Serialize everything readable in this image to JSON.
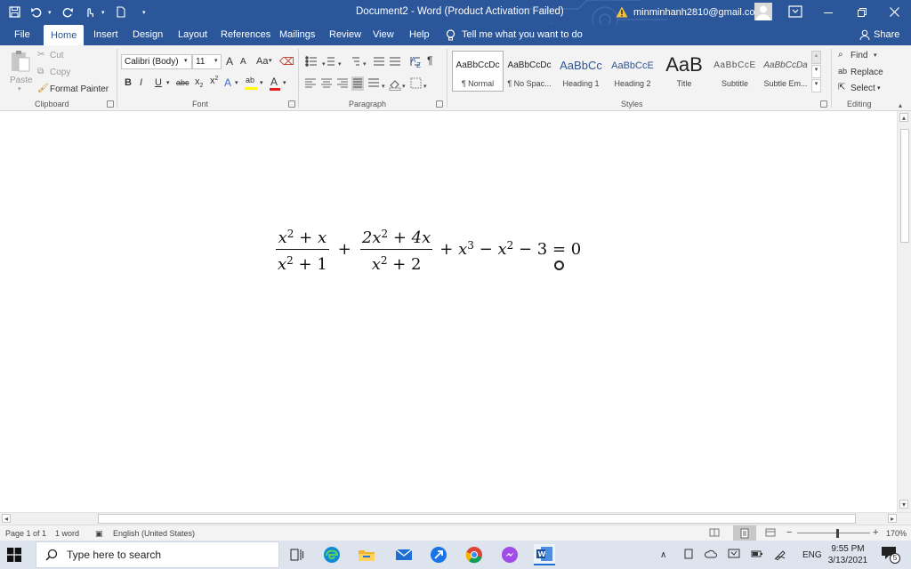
{
  "window": {
    "title": "Document2  -  Word (Product Activation Failed)",
    "account_email": "minminhanh2810@gmail.com"
  },
  "tabs": [
    "File",
    "Home",
    "Insert",
    "Design",
    "Layout",
    "References",
    "Mailings",
    "Review",
    "View",
    "Help"
  ],
  "active_tab": "Home",
  "tell_me": "Tell me what you want to do",
  "share": "Share",
  "clipboard": {
    "paste": "Paste",
    "cut": "Cut",
    "copy": "Copy",
    "format_painter": "Format Painter",
    "label": "Clipboard"
  },
  "font": {
    "name": "Calibri (Body)",
    "size": "11",
    "label": "Font",
    "bold": "B",
    "italic": "I",
    "underline": "U",
    "strike": "abc",
    "subscript": "x",
    "superscript": "x",
    "grow": "A",
    "shrink": "A",
    "case": "Aa",
    "text_effects": "A",
    "font_color": "A"
  },
  "paragraph": {
    "label": "Paragraph",
    "pilcrow": "¶"
  },
  "styles": {
    "label": "Styles",
    "items": [
      {
        "sample": "AaBbCcDc",
        "name": "¶ Normal"
      },
      {
        "sample": "AaBbCcDc",
        "name": "¶ No Spac..."
      },
      {
        "sample": "AaBbCc",
        "name": "Heading 1"
      },
      {
        "sample": "AaBbCcE",
        "name": "Heading 2"
      },
      {
        "sample": "AaB",
        "name": "Title"
      },
      {
        "sample": "AaBbCcE",
        "name": "Subtitle"
      },
      {
        "sample": "AaBbCcDa",
        "name": "Subtle Em..."
      }
    ]
  },
  "editing": {
    "label": "Editing",
    "find": "Find",
    "replace": "Replace",
    "select": "Select"
  },
  "equation": {
    "frac1_num_a": "x",
    "frac1_num_exp": "2",
    "frac1_num_b": "+ x",
    "frac1_den_a": "x",
    "frac1_den_exp": "2",
    "frac1_den_b": "+ 1",
    "plus": "+",
    "frac2_num_a": "2x",
    "frac2_num_exp": "2",
    "frac2_num_b": "+ 4x",
    "frac2_den_a": "x",
    "frac2_den_exp": "2",
    "frac2_den_b": "+ 2",
    "tail_a": "+ x",
    "tail_exp1": "3",
    "tail_b": "− x",
    "tail_exp2": "2",
    "tail_c": "− 3 = 0"
  },
  "status": {
    "page": "Page 1 of 1",
    "words": "1 word",
    "language": "English (United States)",
    "zoom_minus": "−",
    "zoom_plus": "+",
    "zoom": "170%"
  },
  "taskbar": {
    "search_placeholder": "Type here to search",
    "lang": "ENG",
    "time": "9:55 PM",
    "date": "3/13/2021",
    "notifications": "5"
  },
  "colors": {
    "word_blue": "#2b579a",
    "ribbon_bg": "#f3f3f3",
    "taskbar_bg": "#dde4ee",
    "heading_blue": "#2f5496"
  }
}
